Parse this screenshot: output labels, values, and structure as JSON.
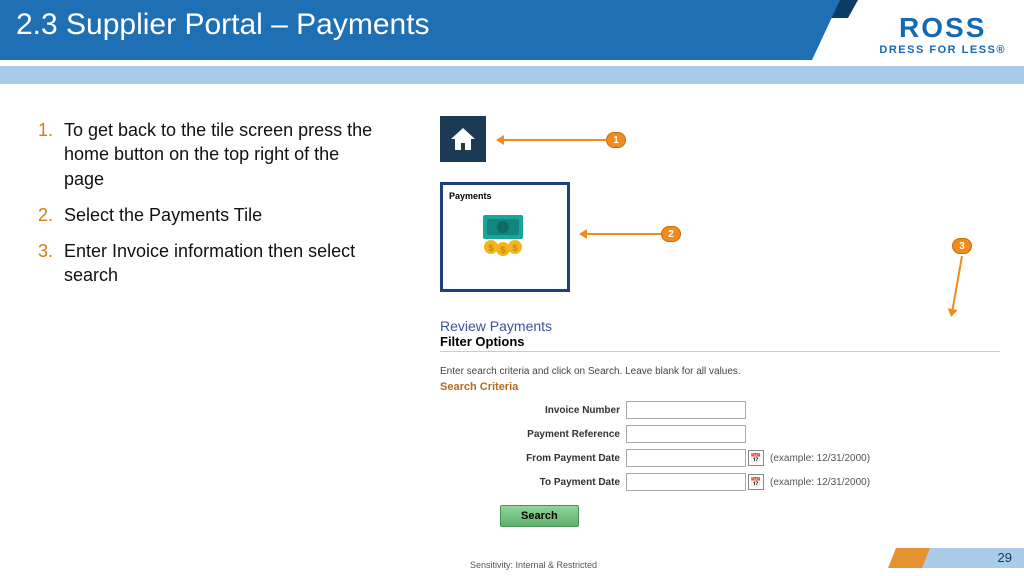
{
  "header": {
    "title": "2.3 Supplier Portal – Payments",
    "logo_main": "ROSS",
    "logo_tag": "DRESS FOR LESS®"
  },
  "instructions": [
    "To get back to the tile screen press the home button on the top right of the page",
    "Select the Payments Tile",
    "Enter Invoice information then select search"
  ],
  "home_tile": {
    "icon_name": "home-icon"
  },
  "payments_tile": {
    "title": "Payments"
  },
  "review_panel": {
    "heading": "Review Payments",
    "subheading": "Filter Options",
    "hint": "Enter search criteria and click on Search. Leave blank for all values.",
    "criteria_label": "Search Criteria",
    "fields": {
      "invoice_number": {
        "label": "Invoice Number",
        "value": ""
      },
      "payment_reference": {
        "label": "Payment Reference",
        "value": ""
      },
      "from_payment_date": {
        "label": "From Payment Date",
        "value": "",
        "example": "(example: 12/31/2000)"
      },
      "to_payment_date": {
        "label": "To Payment Date",
        "value": "",
        "example": "(example: 12/31/2000)"
      }
    },
    "search_button": "Search"
  },
  "callouts": {
    "c1": "1",
    "c2": "2",
    "c3": "3"
  },
  "footer": {
    "sensitivity": "Sensitivity: Internal & Restricted",
    "page_number": "29"
  }
}
